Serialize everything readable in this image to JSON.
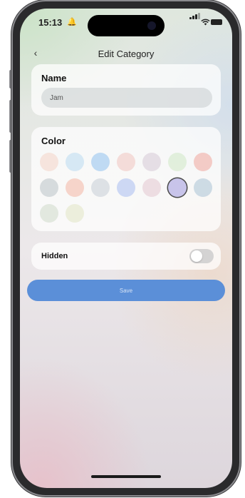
{
  "status_bar": {
    "time": "15:13",
    "bell_icon": "🔔",
    "wifi_icon": "wifi-icon",
    "battery_icon": "battery-icon"
  },
  "nav": {
    "back_glyph": "‹",
    "title": "Edit Category"
  },
  "name_section": {
    "label": "Name",
    "value": "Jam"
  },
  "color_section": {
    "label": "Color",
    "swatches": [
      {
        "color": "#f4d3c6",
        "selected": false
      },
      {
        "color": "#b9daf0",
        "selected": false
      },
      {
        "color": "#8fc1ee",
        "selected": false
      },
      {
        "color": "#f0c4bf",
        "selected": false
      },
      {
        "color": "#d6c8d6",
        "selected": false
      },
      {
        "color": "#cfe8c4",
        "selected": false
      },
      {
        "color": "#f0a69c",
        "selected": false
      },
      {
        "color": "#b9c3c6",
        "selected": false
      },
      {
        "color": "#f4b6a4",
        "selected": false
      },
      {
        "color": "#c6cdd6",
        "selected": false
      },
      {
        "color": "#a9bdf0",
        "selected": false
      },
      {
        "color": "#e4c6cf",
        "selected": false
      },
      {
        "color": "#c8c4ea",
        "selected": true
      },
      {
        "color": "#a9c3d6",
        "selected": false
      },
      {
        "color": "#d0dbcb",
        "selected": false
      },
      {
        "color": "#e1e6c4",
        "selected": false
      }
    ]
  },
  "hidden_section": {
    "label": "Hidden",
    "enabled": false
  },
  "save_label": "Save"
}
